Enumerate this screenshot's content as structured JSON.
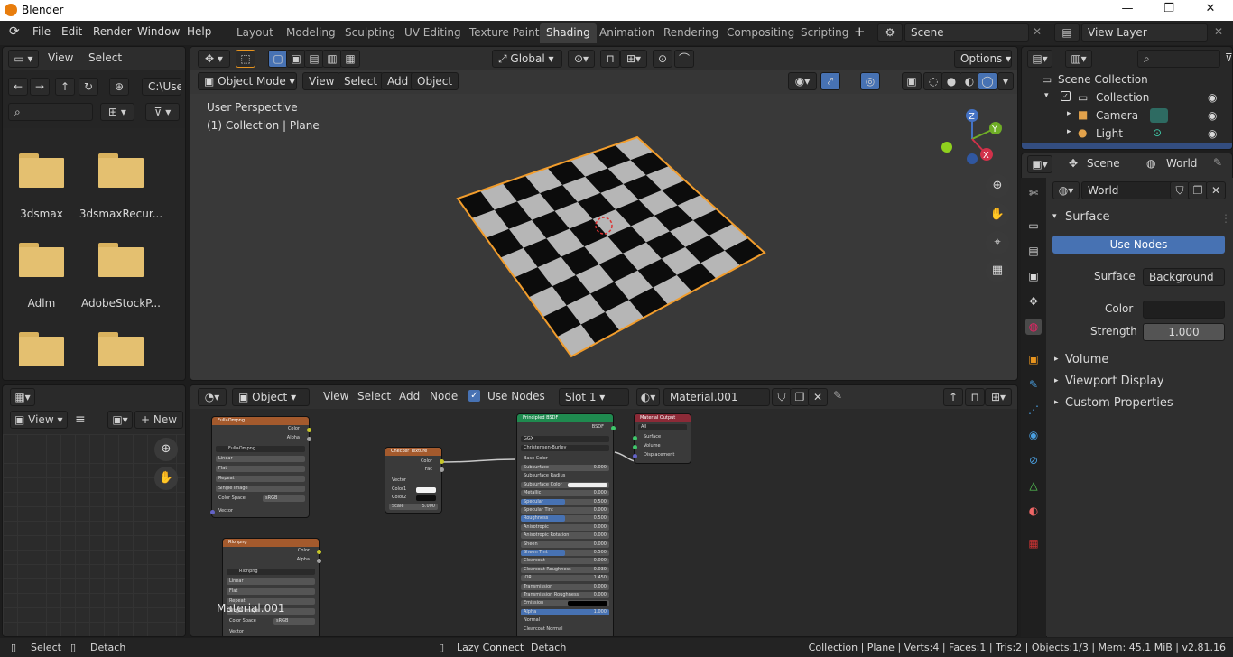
{
  "window": {
    "title": "Blender",
    "controls": [
      "—",
      "❐",
      "✕"
    ]
  },
  "menu": [
    "File",
    "Edit",
    "Render",
    "Window",
    "Help"
  ],
  "workspace_tabs": [
    "Layout",
    "Modeling",
    "Sculpting",
    "UV Editing",
    "Texture Paint",
    "Shading",
    "Animation",
    "Rendering",
    "Compositing",
    "Scripting"
  ],
  "active_tab": "Shading",
  "scene": {
    "name": "Scene",
    "view_layer": "View Layer"
  },
  "file_browser": {
    "header": {
      "view": "View",
      "select": "Select"
    },
    "path": "C:\\Use",
    "folders": [
      "3dsmax",
      "3dsmaxRecur...",
      "Adlm",
      "AdobeStockP..."
    ]
  },
  "image_editor": {
    "view": "View",
    "new": "New",
    "material_label": "Material.001"
  },
  "viewport": {
    "transform": "Global",
    "options": "Options",
    "mode": "Object Mode",
    "menus": [
      "View",
      "Select",
      "Add",
      "Object"
    ],
    "perspective": "User Perspective",
    "collection_info": "(1) Collection | Plane",
    "axes": {
      "x": "X",
      "y": "Y",
      "z": "Z"
    }
  },
  "node_editor": {
    "type": "Object",
    "menus": [
      "View",
      "Select",
      "Add",
      "Node"
    ],
    "use_nodes": "Use Nodes",
    "slot": "Slot 1",
    "material": "Material.001",
    "nodes": {
      "img1": {
        "title": "FulIaOmpng",
        "out": [
          "Color",
          "Alpha"
        ],
        "image": "FulIaOmpng",
        "rows": [
          "Linear",
          "Flat",
          "Repeat",
          "Single Image"
        ],
        "colorspace_label": "Color Space",
        "colorspace": "sRGB",
        "vector": "Vector"
      },
      "img2": {
        "title": "Rlonpng",
        "out": [
          "Color",
          "Alpha"
        ],
        "image": "Rlonpng",
        "rows": [
          "Linear",
          "Flat",
          "Repeat",
          "Single Image"
        ],
        "colorspace_label": "Color Space",
        "colorspace": "sRGB",
        "vector": "Vector"
      },
      "checker": {
        "title": "Checker Texture",
        "out": [
          "Color",
          "Fac"
        ],
        "inputs": [
          "Vector",
          "Color1",
          "Color2"
        ],
        "scale_label": "Scale",
        "scale": "5.000"
      },
      "bsdf": {
        "title": "Principled BSDF",
        "out": "BSDF",
        "dist": "GGX",
        "sss": "Christensen-Burley",
        "base_color": "Base Color",
        "rows": [
          {
            "n": "Subsurface",
            "v": "0.000"
          },
          {
            "n": "Subsurface Radius",
            "v": ""
          },
          {
            "n": "Subsurface Color",
            "v": ""
          },
          {
            "n": "Metallic",
            "v": "0.000"
          },
          {
            "n": "Specular",
            "v": "0.500"
          },
          {
            "n": "Specular Tint",
            "v": "0.000"
          },
          {
            "n": "Roughness",
            "v": "0.500"
          },
          {
            "n": "Anisotropic",
            "v": "0.000"
          },
          {
            "n": "Anisotropic Rotation",
            "v": "0.000"
          },
          {
            "n": "Sheen",
            "v": "0.000"
          },
          {
            "n": "Sheen Tint",
            "v": "0.500"
          },
          {
            "n": "Clearcoat",
            "v": "0.000"
          },
          {
            "n": "Clearcoat Roughness",
            "v": "0.030"
          },
          {
            "n": "IOR",
            "v": "1.450"
          },
          {
            "n": "Transmission",
            "v": "0.000"
          },
          {
            "n": "Transmission Roughness",
            "v": "0.000"
          },
          {
            "n": "Emission",
            "v": ""
          },
          {
            "n": "Alpha",
            "v": "1.000"
          },
          {
            "n": "Normal",
            "v": ""
          },
          {
            "n": "Clearcoat Normal",
            "v": ""
          }
        ]
      },
      "output": {
        "title": "Material Output",
        "target": "All",
        "inputs": [
          "Surface",
          "Volume",
          "Displacement"
        ]
      }
    }
  },
  "outliner": {
    "root": "Scene Collection",
    "items": [
      {
        "label": "Collection"
      },
      {
        "label": "Camera"
      },
      {
        "label": "Light"
      }
    ]
  },
  "properties": {
    "breadcrumb": [
      "Scene",
      "World"
    ],
    "world_name": "World",
    "surface_panel": "Surface",
    "use_nodes": "Use Nodes",
    "surface_label": "Surface",
    "surface_value": "Background",
    "color_label": "Color",
    "strength_label": "Strength",
    "strength_value": "1.000",
    "collapsed_panels": [
      "Volume",
      "Viewport Display",
      "Custom Properties"
    ]
  },
  "status": {
    "left": [
      "Select",
      "Detach",
      "Lazy Connect",
      "Detach"
    ],
    "right": "Collection | Plane | Verts:4 | Faces:1 | Tris:2 | Objects:1/3 | Mem: 45.1 MiB | v2.81.16"
  },
  "colors": {
    "accent": "#4772b3",
    "orange": "#e8941e",
    "bg": "#1d1d1d",
    "panel": "#303030"
  }
}
